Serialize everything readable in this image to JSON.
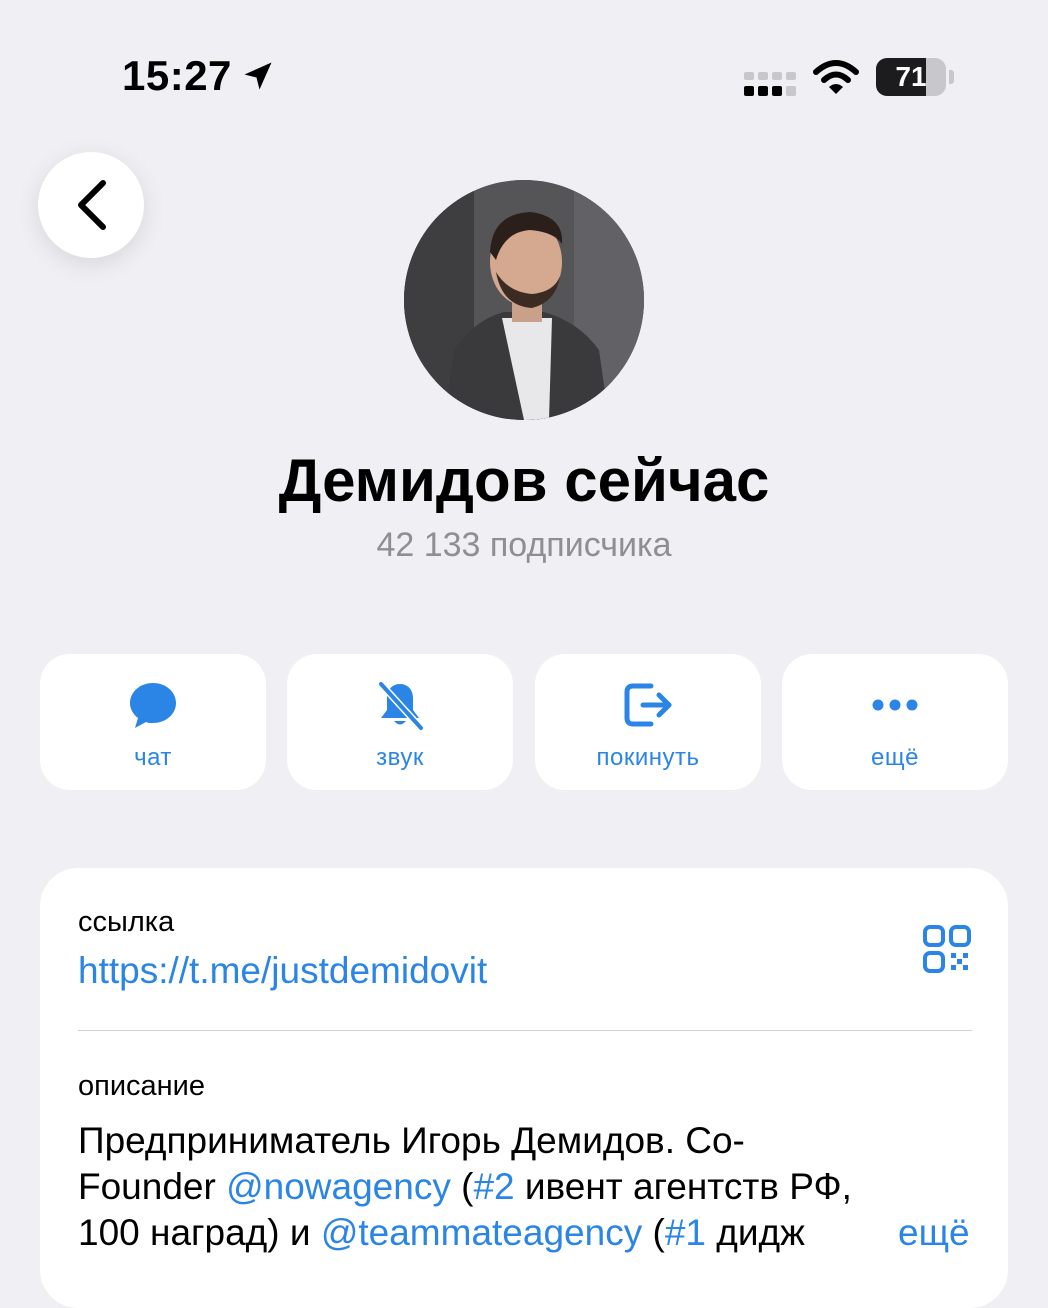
{
  "status_bar": {
    "time": "15:27",
    "battery": "71",
    "battery_level": 0.71
  },
  "header": {
    "back_icon": "chevron-left-icon"
  },
  "channel": {
    "name": "Демидов сейчас",
    "subscribers": "42 133 подписчика"
  },
  "actions": [
    {
      "label": "чат",
      "icon": "chat-bubble-icon"
    },
    {
      "label": "звук",
      "icon": "bell-slash-icon"
    },
    {
      "label": "покинуть",
      "icon": "leave-icon"
    },
    {
      "label": "ещё",
      "icon": "more-dots-icon"
    }
  ],
  "info": {
    "link_label": "ссылка",
    "link_value": "https://t.me/justdemidovit",
    "qr_icon": "qr-code-icon",
    "description_label": "описание",
    "description": {
      "line1": "Предприниматель Игорь Демидов. Co-",
      "line2_a": "Founder ",
      "line2_link": "@nowagency",
      "line2_b": " (",
      "line2_tag": "#2",
      "line2_c": " ивент агентств РФ,",
      "line3_a": "100 наград) и ",
      "line3_link": "@teammateagency",
      "line3_b": " (",
      "line3_tag": "#1",
      "line3_c": " дидж"
    },
    "more_label": "ещё"
  },
  "colors": {
    "accent": "#2a85e6",
    "background": "#efeff4",
    "secondary_text": "#8e8e93"
  }
}
